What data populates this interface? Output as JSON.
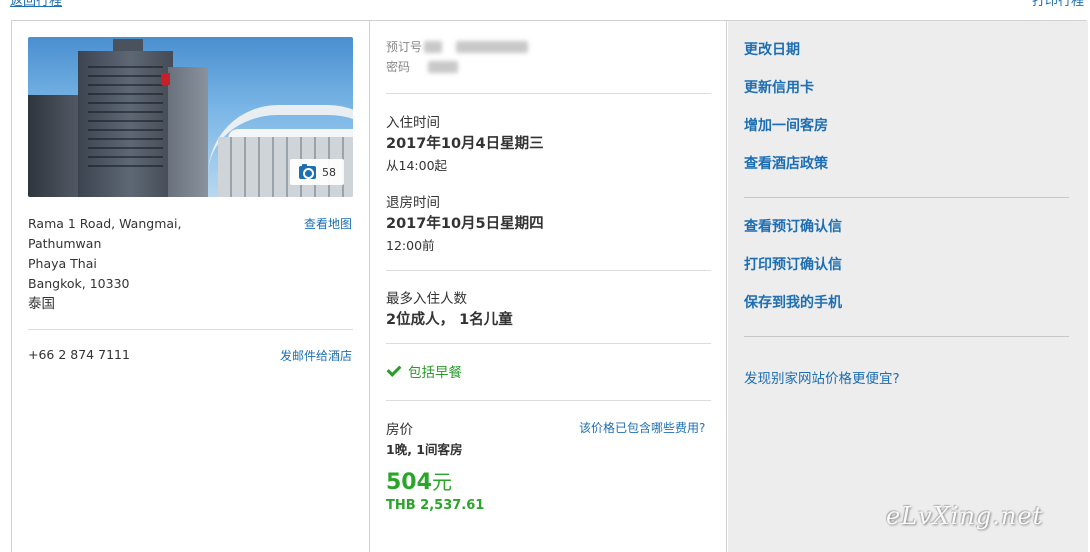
{
  "top": {
    "left_link": "返回行程",
    "right_link": "打印行程"
  },
  "hotel": {
    "photo_count": "58",
    "address_lines": [
      "Rama 1 Road, Wangmai,",
      "Pathumwan",
      "Phaya Thai",
      "Bangkok, 10330"
    ],
    "country": "泰国",
    "map_link": "查看地图",
    "phone": "+66 2 874 7111",
    "email_link": "发邮件给酒店"
  },
  "booking": {
    "confirmation_label": "预订号",
    "pin_label": "密码",
    "checkin_label": "入住时间",
    "checkin_date": "2017年10月4日星期三",
    "checkin_time": "从14:00起",
    "checkout_label": "退房时间",
    "checkout_date": "2017年10月5日星期四",
    "checkout_time": "12:00前",
    "occupancy_label": "最多入住人数",
    "occupancy_value": "2位成人， 1名儿童",
    "breakfast": "包括早餐",
    "price_label": "房价",
    "price_detail": "1晚, 1间客房",
    "fee_link": "该价格已包含哪些费用?",
    "price_amount": "504",
    "price_unit": "元",
    "price_thb": "THB 2,537.61"
  },
  "actions": {
    "change_dates": "更改日期",
    "update_card": "更新信用卡",
    "add_room": "增加一间客房",
    "view_policy": "查看酒店政策",
    "view_confirmation": "查看预订确认信",
    "print_confirmation": "打印预订确认信",
    "save_to_phone": "保存到我的手机",
    "cheaper_elsewhere": "发现别家网站价格更便宜?"
  },
  "watermark": "eLvXing.net",
  "colors": {
    "link": "#1d6eb3",
    "price_green": "#2aa52a",
    "right_panel_bg": "#ededed",
    "border": "#d2d2d2"
  }
}
